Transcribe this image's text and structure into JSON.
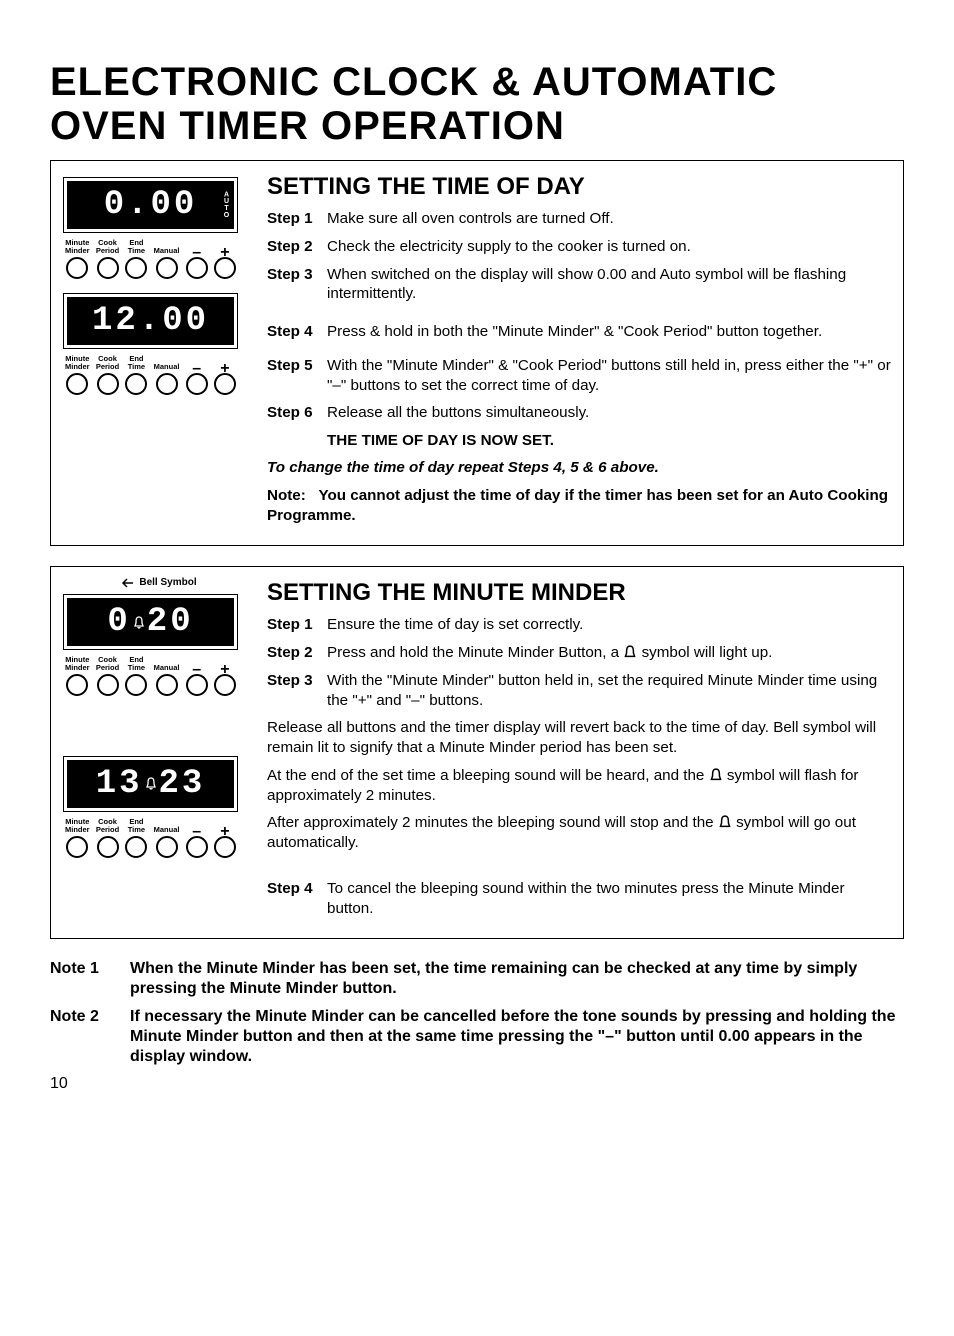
{
  "title": "ELECTRONIC CLOCK & AUTOMATIC OVEN TIMER OPERATION",
  "timer_buttons": [
    "Minute\nMinder",
    "Cook\nPeriod",
    "End\nTime",
    "Manual",
    "–",
    "+"
  ],
  "auto_letters": "AUTO",
  "section1": {
    "heading": "SETTING THE TIME OF DAY",
    "steps": [
      {
        "label": "Step 1",
        "text": "Make sure all oven controls are turned Off."
      },
      {
        "label": "Step 2",
        "text": "Check the electricity supply to the cooker is turned on."
      },
      {
        "label": "Step 3",
        "text": "When switched on the display will show 0.00 and Auto symbol will be flashing intermittently."
      },
      {
        "label": "Step 4",
        "text": "Press & hold in both the \"Minute Minder\" & \"Cook Period\" button together."
      },
      {
        "label": "Step 5",
        "text": "With the \"Minute Minder\" & \"Cook Period\" buttons still held in, press either the \"+\" or \"–\" buttons to set the correct time of day."
      },
      {
        "label": "Step 6",
        "text": "Release all the buttons simultaneously."
      }
    ],
    "confirm": "THE TIME OF DAY IS NOW SET.",
    "change": "To change the time of day repeat Steps 4, 5 & 6 above.",
    "note_label": "Note:",
    "note_text": "You cannot adjust the time of day if the timer has been set for an Auto Cooking Programme.",
    "display1": "0.00",
    "display2": "12.00"
  },
  "section2": {
    "bell_callout": "Bell Symbol",
    "heading": "SETTING THE MINUTE MINDER",
    "steps1": [
      {
        "label": "Step 1",
        "text": "Ensure the time of day is set correctly."
      },
      {
        "label": "Step 2",
        "text": "Press and hold the Minute Minder Button, a "
      },
      {
        "label": "Step 3",
        "text": "With the \"Minute Minder\" button held in, set the required Minute Minder time using the \"+\" and \"–\" buttons."
      }
    ],
    "step2_tail": " symbol will light up.",
    "para1": "Release all buttons and the timer display will revert back to the time of day. Bell symbol will remain lit to signify that a Minute Minder period has been set.",
    "para2a": "At the end of the set time a bleeping sound will be heard, and the ",
    "para2b": " symbol will flash for approximately 2 minutes.",
    "para3a": "After approximately 2 minutes the bleeping sound will stop and the ",
    "para3b": " symbol will go out automatically.",
    "step4": {
      "label": "Step 4",
      "text": "To cancel the bleeping sound within the two minutes press the Minute Minder button."
    },
    "display1": "0.20",
    "display2": "13.23"
  },
  "notes": [
    {
      "label": "Note 1",
      "text": "When the Minute Minder has been set, the time remaining can be checked at any time by simply pressing the Minute Minder button."
    },
    {
      "label": "Note 2",
      "text": "If necessary the Minute Minder can be cancelled before the tone sounds by pressing and holding the Minute Minder button and then at the same time pressing the \"–\" button until 0.00 appears in the display window."
    }
  ],
  "page_number": "10"
}
